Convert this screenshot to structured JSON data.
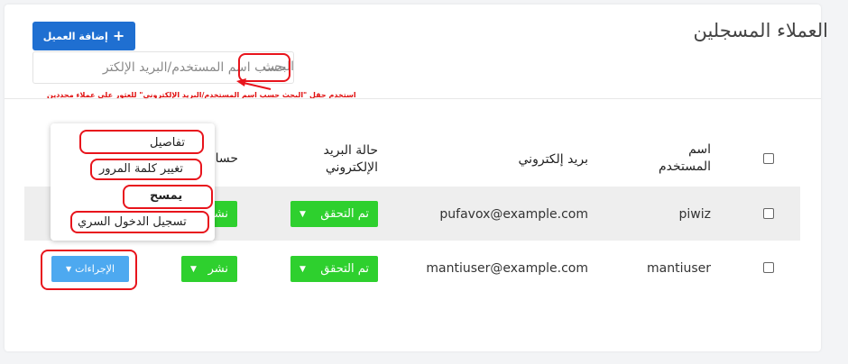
{
  "header": {
    "title": "العملاء المسجلين",
    "add_button_label": "إضافة العميل",
    "add_icon": "plus-icon"
  },
  "search": {
    "highlight": "البحث",
    "placeholder": "حسب اسم المستخدم/البريد الإلكتر"
  },
  "annotation_hint": "استخدم حقل \"البحث حسب اسم المستخدم/البريد الإلكتروني\" للعثور على عملاء محددين",
  "table": {
    "headers": {
      "username_line1": "اسم",
      "username_line2": "المستخدم",
      "email": "بريد إلكتروني",
      "email_status_line1": "حالة البريد",
      "email_status_line2": "الإلكتروني",
      "account_partial": "حسا"
    },
    "rows": [
      {
        "username": "piwiz",
        "email": "pufavox@example.com",
        "email_status": "تم التحقق",
        "account_status": "نشر"
      },
      {
        "username": "mantiuser",
        "email": "mantiuser@example.com",
        "email_status": "تم التحقق",
        "account_status": "نشر"
      }
    ]
  },
  "actions": {
    "button_label": "الإجراءات",
    "menu": [
      {
        "label": "تفاصيل"
      },
      {
        "label": "تغيير كلمة المرور"
      },
      {
        "label": "يمسح"
      },
      {
        "label": "تسجيل الدخول السري"
      }
    ]
  },
  "colors": {
    "primary": "#1f6fd1",
    "verified": "#2ed02e",
    "actions": "#4da9f0",
    "annotation": "#e8141c"
  }
}
